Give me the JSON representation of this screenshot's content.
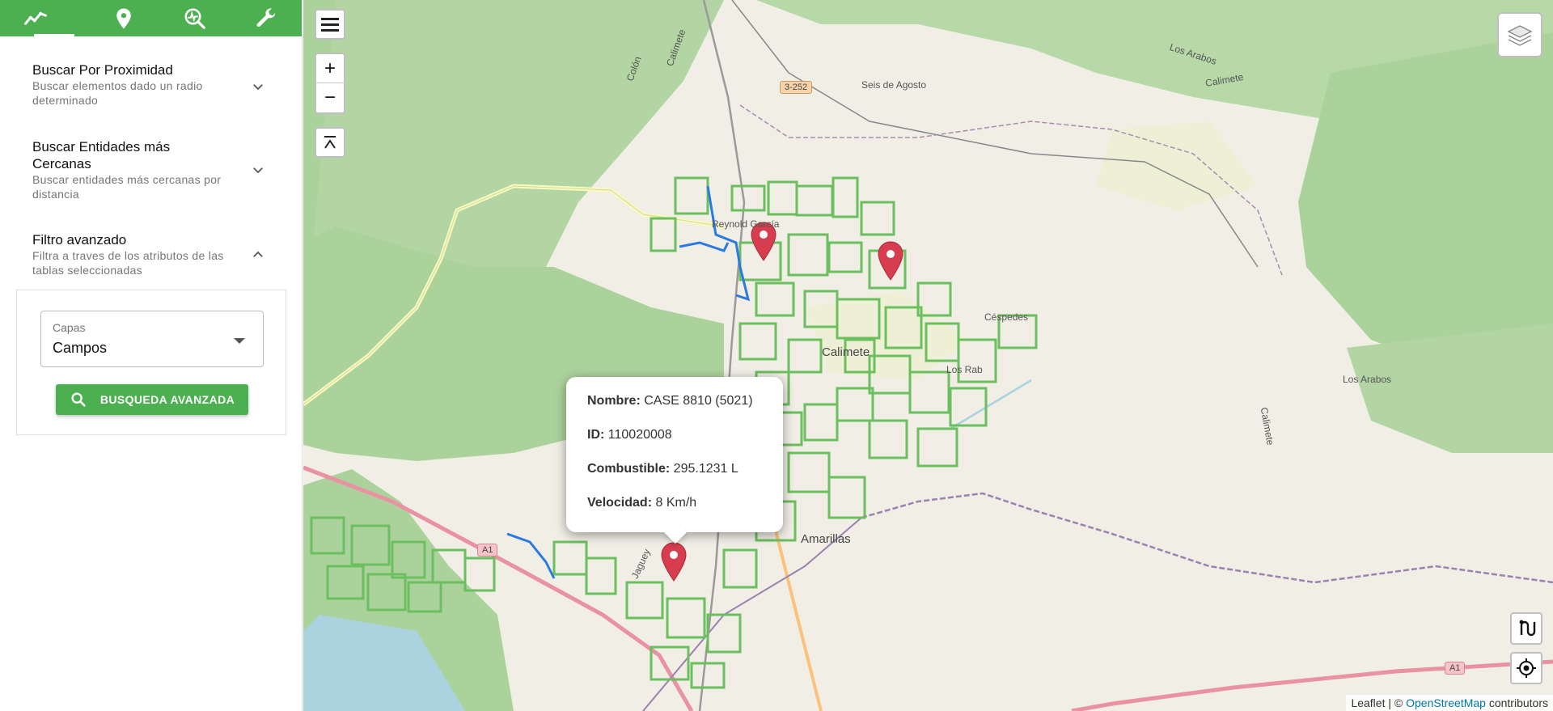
{
  "sidebar": {
    "tabs": [
      {
        "icon": "trending-line-icon",
        "active": true
      },
      {
        "icon": "location-pin-icon",
        "active": false
      },
      {
        "icon": "search-analytics-icon",
        "active": false
      },
      {
        "icon": "wrench-icon",
        "active": false
      }
    ],
    "accordions": [
      {
        "title": "Buscar Por Proximidad",
        "subtitle": "Buscar elementos dado un radio determinado",
        "expanded": false
      },
      {
        "title": "Buscar Entidades más Cercanas",
        "subtitle": "Buscar entidades más cercanas por distancia",
        "expanded": false
      },
      {
        "title": "Filtro avanzado",
        "subtitle": "Filtra a traves de los atributos de las tablas seleccionadas",
        "expanded": true
      }
    ],
    "filter": {
      "select_label": "Capas",
      "select_value": "Campos",
      "button_label": "BUSQUEDA AVANZADA"
    }
  },
  "map": {
    "controls": {
      "zoom_in": "+",
      "zoom_out": "−"
    },
    "labels": {
      "seis_de_agosto": "Seis de Agosto",
      "reynold": "Reynold García",
      "calimete": "Calimete",
      "amarillas": "Amarillas",
      "los_arabos_top": "Los Arabos",
      "los_arabos_right": "Los Arabos",
      "calimete_river": "Calimete",
      "calimete_river2": "Calimete",
      "cespedes": "Céspedes",
      "jaguey": "Jaguey",
      "colon": "Colón",
      "calimete_road": "Calimete",
      "los_rab": "Los Rab"
    },
    "shields": {
      "r3252": "3-252",
      "a1_left": "A1",
      "a1_right": "A1"
    },
    "popup": {
      "nombre_label": "Nombre:",
      "nombre_value": "CASE 8810 (5021)",
      "id_label": "ID:",
      "id_value": "110020008",
      "combustible_label": "Combustible:",
      "combustible_value": "295.1231 L",
      "velocidad_label": "Velocidad:",
      "velocidad_value": "8 Km/h"
    },
    "attribution": {
      "leaflet": "Leaflet",
      "sep": " | © ",
      "osm": "OpenStreetMap",
      "contributors": " contributors"
    },
    "colors": {
      "accent": "#4caf50",
      "marker": "#d63e4f",
      "track": "#2a7ae2",
      "field": "#6cbf5e",
      "forest": "#acd29c"
    }
  }
}
